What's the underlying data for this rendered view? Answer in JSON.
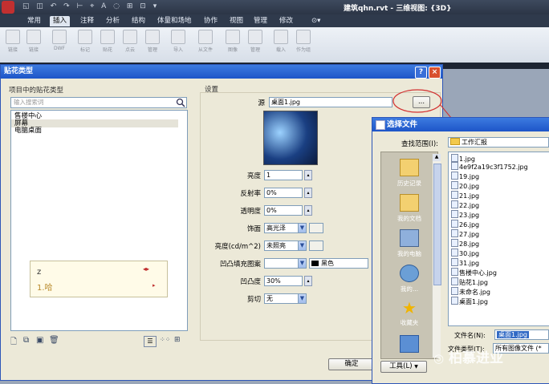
{
  "app": {
    "title": "建筑qhn.rvt - 三维视图: {3D}",
    "quick_access": "▾"
  },
  "ribbon": {
    "tabs": [
      "常用",
      "插入",
      "注释",
      "分析",
      "结构",
      "体量和场地",
      "协作",
      "视图",
      "管理",
      "修改",
      "⊙▾"
    ],
    "active_tab": "插入",
    "buttons": [
      "链接",
      "链接",
      "DWF",
      "标记",
      "贴花",
      "点云",
      "管理",
      "导入",
      "从文件",
      "图像",
      "管理",
      "载入",
      "作为组"
    ]
  },
  "decal_dialog": {
    "title": "贴花类型",
    "left_label": "项目中的贴花类型",
    "search_placeholder": "输入搜索词",
    "types": [
      "售楼中心",
      "屏幕",
      "电脑桌面"
    ],
    "selected_type": "屏幕",
    "settings_label": "设置",
    "source_label": "源",
    "source_value": "桌面1.jpg",
    "browse_button": "...",
    "props": [
      {
        "label": "亮度",
        "value": "1",
        "kind": "spin"
      },
      {
        "label": "反射率",
        "value": "0%",
        "kind": "spin"
      },
      {
        "label": "透明度",
        "value": "0%",
        "kind": "spin"
      },
      {
        "label": "饰面",
        "value": "高光泽",
        "kind": "select"
      },
      {
        "label": "亮度(cd/m^2)",
        "value": "未照亮",
        "kind": "select"
      },
      {
        "label": "凹凸填充图案",
        "value": "",
        "kind": "select",
        "color_label": "黑色"
      },
      {
        "label": "凹凸度",
        "value": "30%",
        "kind": "spin"
      },
      {
        "label": "剪切",
        "value": "无",
        "kind": "select"
      }
    ],
    "ok_button": "确定",
    "help_button": "?",
    "close_button": "×"
  },
  "ime": {
    "composition": "z",
    "candidate": "1.哈",
    "arrows": "◂▸"
  },
  "file_dialog": {
    "title": "选择文件",
    "look_in_label": "查找范围(I):",
    "look_in_value": "工作汇报",
    "places": [
      "历史记录",
      "我的文档",
      "我的电脑",
      "我的...",
      "收藏夹"
    ],
    "files": [
      "1.jpg",
      "4e9f2a19c3f1752.jpg",
      "19.jpg",
      "20.jpg",
      "21.jpg",
      "22.jpg",
      "23.jpg",
      "26.jpg",
      "27.jpg",
      "28.jpg",
      "30.jpg",
      "31.jpg",
      "售楼中心.jpg",
      "贴花1.jpg",
      "未命名.jpg",
      "桌面1.jpg"
    ],
    "filename_label": "文件名(N):",
    "filename_value": "桌面1.jpg",
    "filetype_label": "文件类型(T):",
    "filetype_value": "所有图像文件 (*",
    "tools_button": "工具(L)"
  },
  "watermark": "柏慕进业",
  "colors": {
    "accent": "#1d55c8",
    "dialog_bg": "#ece9d8",
    "arrow": "#d23030"
  }
}
